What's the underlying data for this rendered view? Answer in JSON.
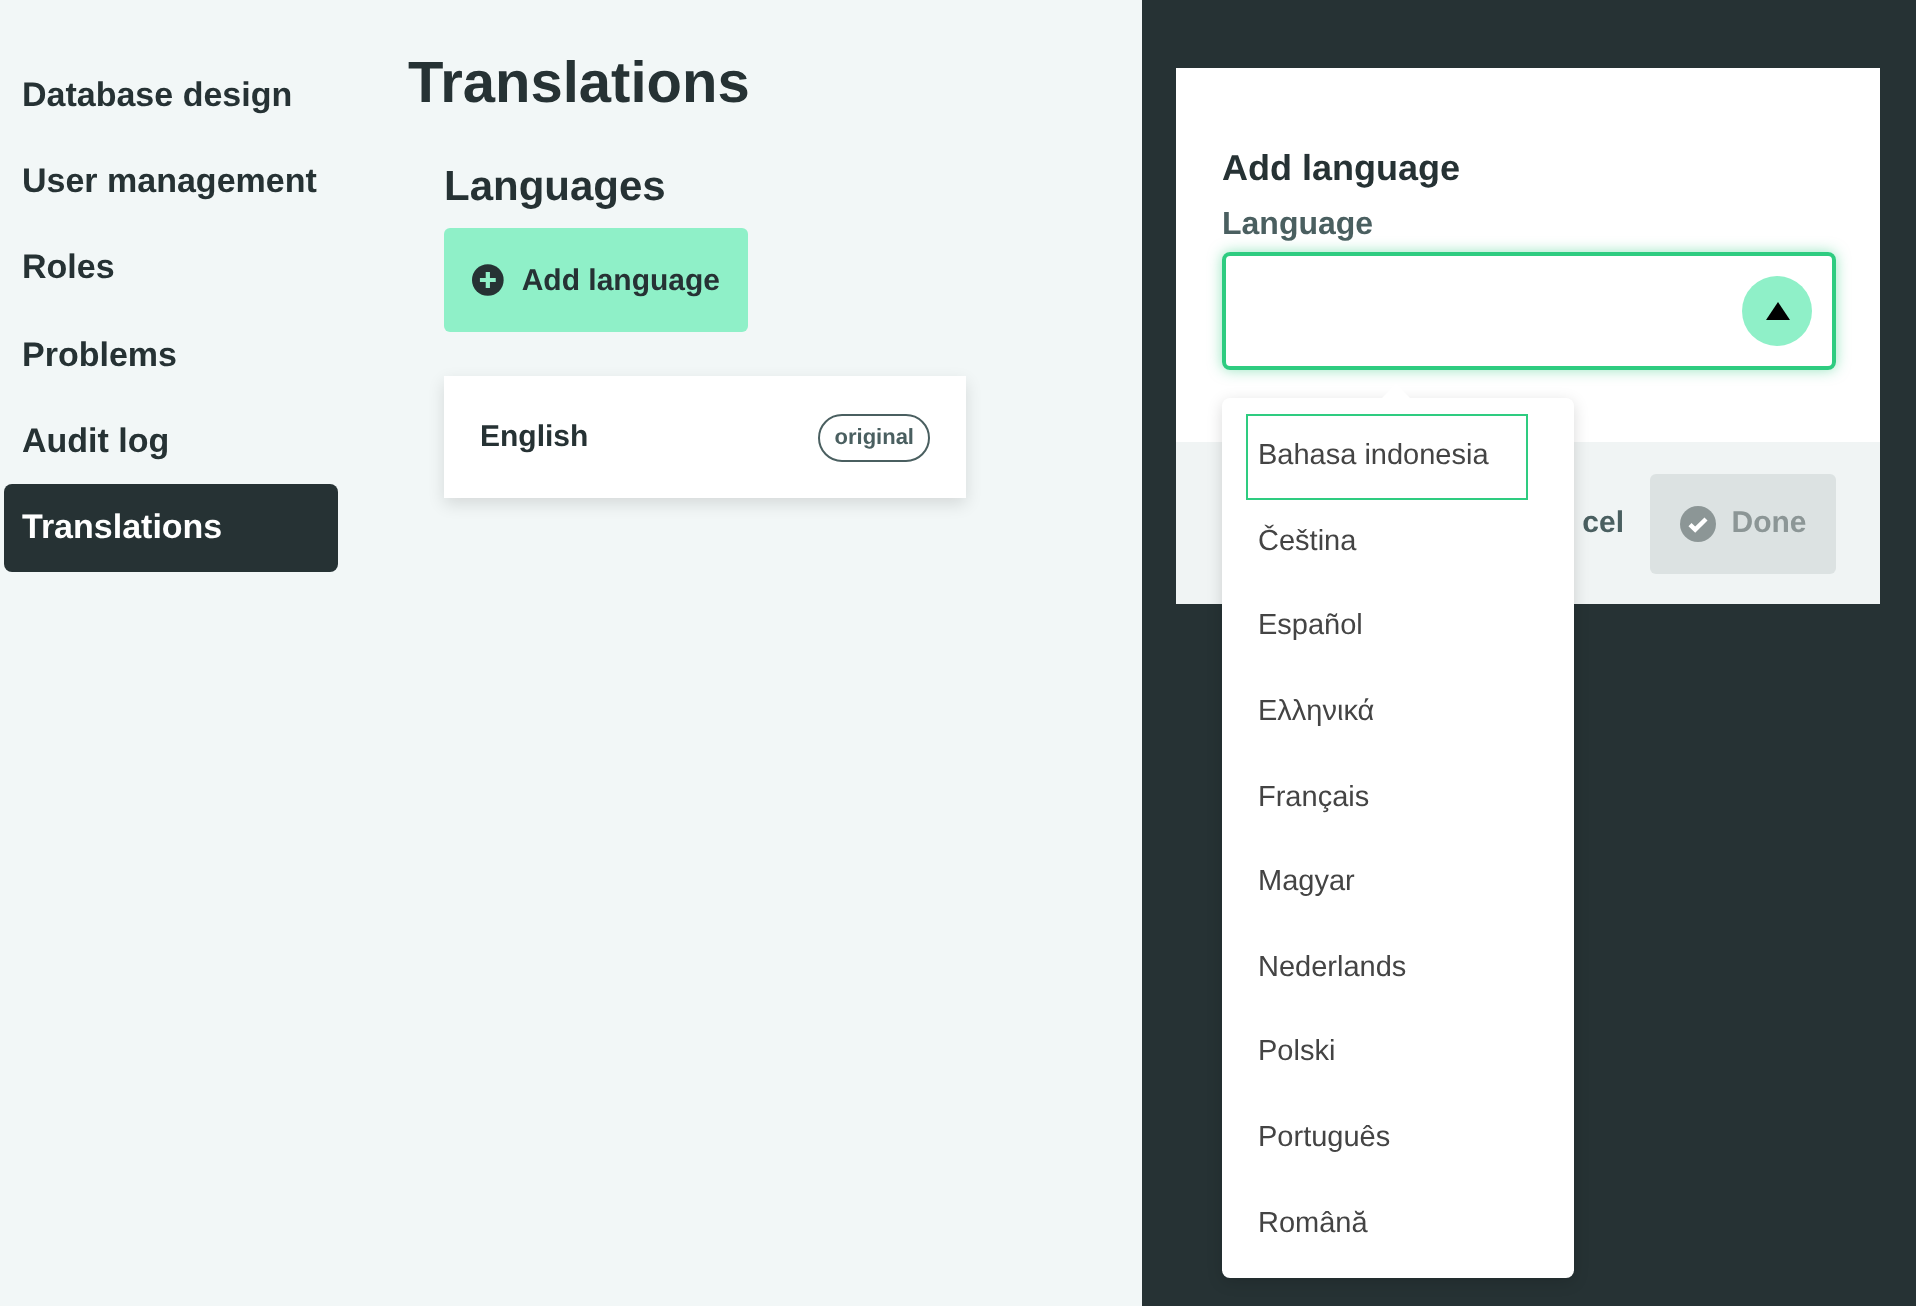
{
  "sidebar": {
    "items": [
      {
        "label": "Database design",
        "selected": false
      },
      {
        "label": "User management",
        "selected": false
      },
      {
        "label": "Roles",
        "selected": false
      },
      {
        "label": "Problems",
        "selected": false
      },
      {
        "label": "Audit log",
        "selected": false
      },
      {
        "label": "Translations",
        "selected": true
      }
    ]
  },
  "page": {
    "title": "Translations",
    "section_title": "Languages",
    "add_button": "Add language",
    "languages": [
      {
        "name": "English",
        "badge": "original"
      }
    ]
  },
  "dialog": {
    "title": "Add language",
    "field_label": "Language",
    "expanded": true,
    "options": [
      {
        "label": "Bahasa indonesia",
        "selected": true
      },
      {
        "label": "Čeština",
        "selected": false
      },
      {
        "label": "Español",
        "selected": false
      },
      {
        "label": "Ελληνικά",
        "selected": false
      },
      {
        "label": "Français",
        "selected": false
      },
      {
        "label": "Magyar",
        "selected": false
      },
      {
        "label": "Nederlands",
        "selected": false
      },
      {
        "label": "Polski",
        "selected": false
      },
      {
        "label": "Português",
        "selected": false
      },
      {
        "label": "Română",
        "selected": false
      }
    ],
    "cancel_button": "cel",
    "done_button": "Done",
    "done_disabled": true
  }
}
